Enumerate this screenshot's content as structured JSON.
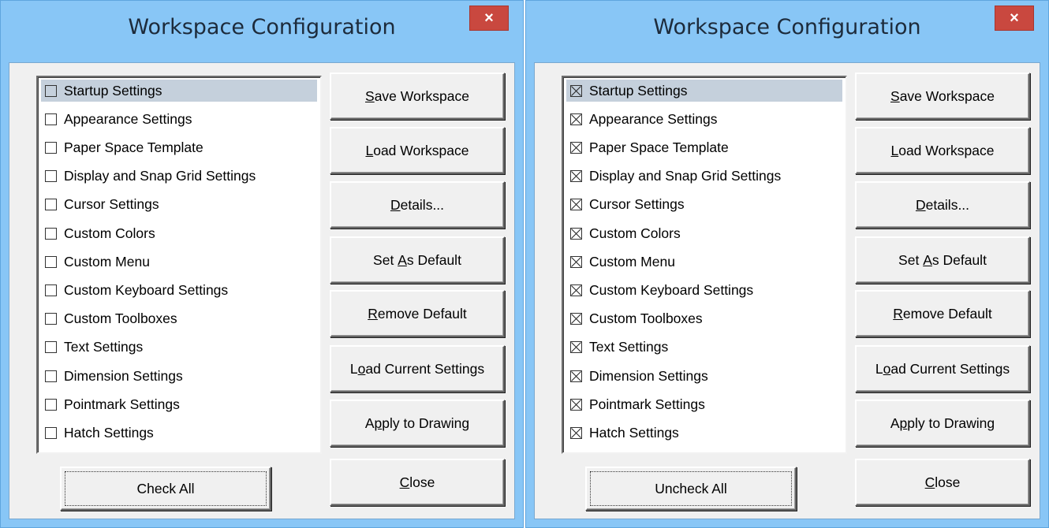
{
  "dialogs": [
    {
      "title": "Workspace Configuration",
      "close_glyph": "×",
      "checked": false,
      "bottom_button": "Check All"
    },
    {
      "title": "Workspace Configuration",
      "close_glyph": "×",
      "checked": true,
      "bottom_button": "Uncheck All"
    }
  ],
  "list_items": [
    "Startup Settings",
    "Appearance Settings",
    "Paper Space Template",
    "Display and Snap Grid Settings",
    "Cursor Settings",
    "Custom Colors",
    "Custom Menu",
    "Custom Keyboard Settings",
    "Custom Toolboxes",
    "Text Settings",
    "Dimension Settings",
    "Pointmark Settings",
    "Hatch Settings"
  ],
  "selected_item": "Startup Settings",
  "buttons": {
    "save": {
      "pre": "",
      "key": "S",
      "post": "ave Workspace"
    },
    "load": {
      "pre": "",
      "key": "L",
      "post": "oad Workspace"
    },
    "details": {
      "pre": "",
      "key": "D",
      "post": "etails..."
    },
    "set_default": {
      "pre": "Set ",
      "key": "A",
      "post": "s Default"
    },
    "remove_default": {
      "pre": "",
      "key": "R",
      "post": "emove Default"
    },
    "load_current": {
      "pre": "L",
      "key": "o",
      "post": "ad Current Settings"
    },
    "apply": {
      "pre": "A",
      "key": "p",
      "post": "ply to Drawing"
    },
    "close": {
      "pre": "",
      "key": "C",
      "post": "lose"
    }
  }
}
